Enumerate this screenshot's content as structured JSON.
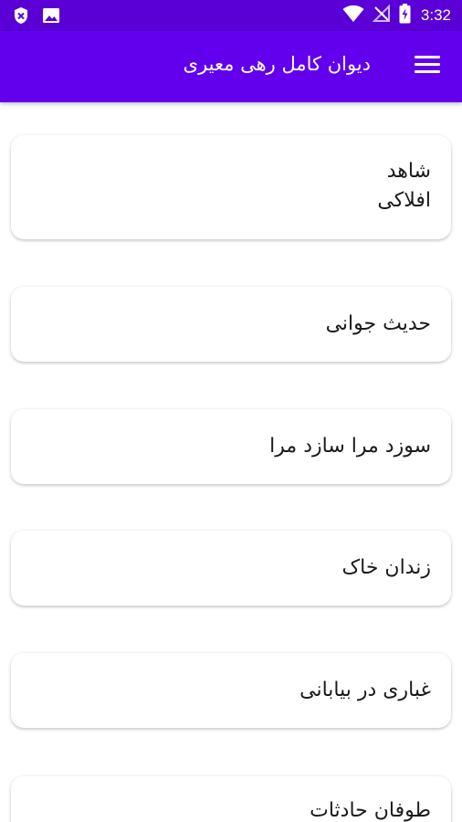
{
  "status_bar": {
    "time": "3:32",
    "icons": [
      "shield-notification-icon",
      "image-notification-icon",
      "wifi-icon",
      "no-signal-icon",
      "battery-charging-icon"
    ]
  },
  "app_bar": {
    "title": "دیوان کامل رهی معیری",
    "menu_icon": "hamburger-menu-icon",
    "background": "#6200ee",
    "status_background": "#5a00d6"
  },
  "poems": [
    {
      "title_line1": "شاهد",
      "title_line2": "افلاکی"
    },
    {
      "title": "حدیث جوانی"
    },
    {
      "title": "سوزد مرا سازد مرا"
    },
    {
      "title": "زندان خاک"
    },
    {
      "title": "غباری در بیابانی"
    },
    {
      "title": "طوفان حادثات"
    }
  ]
}
